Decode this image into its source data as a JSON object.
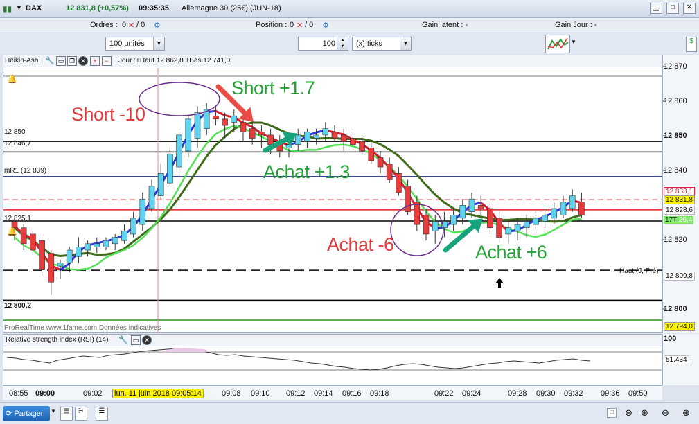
{
  "title_bar": {
    "instrument": "DAX",
    "price_change": "12 831,8 (+0,57%)",
    "time": "09:35:35",
    "contract": "Allemagne 30 (25€) (JUN-18)"
  },
  "orders_bar": {
    "orders_label": "Ordres :",
    "orders_v1": "0",
    "orders_v2": "/ 0",
    "position_label": "Position :",
    "position_v1": "0",
    "position_v2": "/ 0",
    "gain_latent": "Gain latent :  -",
    "gain_jour": "Gain Jour :  -"
  },
  "toolbar": {
    "units": "100 unités",
    "qty": "100",
    "ticks": "(x) ticks"
  },
  "chart_header": {
    "indicator": "Heikin-Ashi",
    "info": "Jour :+Haut 12 862,8 +Bas 12 741,0"
  },
  "chart_labels": {
    "level_12850": "12 850",
    "level_12846": "12 846,7",
    "mr1": "mR1 (12 839)",
    "level_12825": "12 825,1",
    "level_12800": "12 800,2",
    "haut": "Haut (J, Pré)",
    "watermark": "www.1fame.com Données indicatives",
    "watermark_prefix": "ProRealTime"
  },
  "price_axis": {
    "p12870": "12 870",
    "p12860": "12 860",
    "p12850": "12 850",
    "p12840": "12 840",
    "p12833": "12 833,1",
    "p12831": "12 831,8",
    "p12828": "12 828,6",
    "p17t": "17T",
    "p12826": "26,4",
    "p12820": "12 820",
    "p12809": "12 809,8",
    "p12800": "12 800",
    "p12794": "12 794,0"
  },
  "annotations": {
    "short_m10": "Short -10",
    "short_p17": "Short +1.7",
    "achat_p13": "Achat +1.3",
    "achat_m6": "Achat -6",
    "achat_p6": "Achat +6"
  },
  "rsi": {
    "label": "Relative strength index (RSI) (14)",
    "axis_top": "100",
    "value": "51,434"
  },
  "time_axis": {
    "t0855": "08:55",
    "t0900": "09:00",
    "t0902": "09:02",
    "cursor": "lun. 11 juin 2018 09:05:14",
    "t0908": "09:08",
    "t0910": "09:10",
    "t0912": "09:12",
    "t0914": "09:14",
    "t0916": "09:16",
    "t0918": "09:18",
    "t0922": "09:22",
    "t0924": "09:24",
    "t0928": "09:28",
    "t0930": "09:30",
    "t0932": "09:32",
    "t0936": "09:36",
    "t0950": "09:50"
  },
  "bottom": {
    "share": "Partager"
  },
  "chart_data": {
    "type": "candlestick",
    "note_series": [
      "heikin-ashi candles",
      "blue/red moving average",
      "green moving average",
      "dark green moving average"
    ],
    "ylim": [
      12790,
      12873
    ],
    "candles": [
      [
        12825,
        12826,
        12819,
        12823,
        0
      ],
      [
        12823,
        12824,
        12816,
        12818,
        0
      ],
      [
        12821,
        12822,
        12815,
        12816,
        0
      ],
      [
        12819,
        12820,
        12808,
        12810,
        0
      ],
      [
        12815,
        12816,
        12802,
        12806,
        0
      ],
      [
        12811,
        12813,
        12807,
        12812,
        1
      ],
      [
        12812,
        12817,
        12809,
        12816,
        1
      ],
      [
        12814,
        12820,
        12812,
        12817,
        1
      ],
      [
        12816,
        12819,
        12814,
        12818,
        1
      ],
      [
        12817,
        12820,
        12815,
        12818,
        1
      ],
      [
        12817,
        12820,
        12816,
        12819,
        1
      ],
      [
        12818,
        12821,
        12816,
        12820,
        1
      ],
      [
        12819,
        12824,
        12818,
        12822,
        1
      ],
      [
        12821,
        12828,
        12820,
        12826,
        1
      ],
      [
        12824,
        12834,
        12822,
        12832,
        1
      ],
      [
        12829,
        12838,
        12828,
        12836,
        1
      ],
      [
        12833,
        12843,
        12832,
        12840,
        1
      ],
      [
        12837,
        12848,
        12836,
        12846,
        1
      ],
      [
        12842,
        12853,
        12840,
        12852,
        1
      ],
      [
        12847,
        12858,
        12845,
        12857,
        1
      ],
      [
        12851,
        12861,
        12848,
        12859,
        1
      ],
      [
        12854,
        12862,
        12852,
        12860,
        1
      ],
      [
        12857,
        12861,
        12855,
        12858,
        0
      ],
      [
        12857,
        12859,
        12851,
        12855,
        0
      ],
      [
        12856,
        12860,
        12853,
        12858,
        1
      ],
      [
        12856,
        12858,
        12850,
        12853,
        0
      ],
      [
        12854,
        12857,
        12849,
        12851,
        0
      ],
      [
        12853,
        12855,
        12848,
        12852,
        0
      ],
      [
        12852,
        12854,
        12846,
        12849,
        0
      ],
      [
        12850,
        12852,
        12845,
        12847,
        0
      ],
      [
        12848,
        12851,
        12845,
        12849,
        1
      ],
      [
        12849,
        12854,
        12847,
        12852,
        1
      ],
      [
        12850,
        12854,
        12848,
        12853,
        1
      ],
      [
        12851,
        12854,
        12849,
        12852,
        1
      ],
      [
        12852,
        12856,
        12850,
        12854,
        1
      ],
      [
        12853,
        12855,
        12850,
        12851,
        0
      ],
      [
        12852,
        12854,
        12847,
        12850,
        0
      ],
      [
        12851,
        12853,
        12848,
        12849,
        0
      ],
      [
        12850,
        12852,
        12846,
        12847,
        0
      ],
      [
        12848,
        12850,
        12843,
        12844,
        0
      ],
      [
        12845,
        12847,
        12840,
        12842,
        0
      ],
      [
        12843,
        12845,
        12837,
        12838,
        0
      ],
      [
        12840,
        12842,
        12833,
        12834,
        0
      ],
      [
        12836,
        12838,
        12827,
        12828,
        0
      ],
      [
        12831,
        12833,
        12822,
        12824,
        0
      ],
      [
        12827,
        12829,
        12819,
        12821,
        0
      ],
      [
        12825,
        12827,
        12818,
        12822,
        1
      ],
      [
        12823,
        12828,
        12820,
        12825,
        1
      ],
      [
        12824,
        12829,
        12822,
        12827,
        1
      ],
      [
        12826,
        12832,
        12824,
        12830,
        1
      ],
      [
        12828,
        12834,
        12826,
        12832,
        1
      ],
      [
        12830,
        12833,
        12827,
        12829,
        0
      ],
      [
        12829,
        12831,
        12821,
        12823,
        0
      ],
      [
        12826,
        12828,
        12818,
        12820,
        0
      ],
      [
        12823,
        12825,
        12818,
        12821,
        1
      ],
      [
        12822,
        12826,
        12819,
        12824,
        1
      ],
      [
        12823,
        12827,
        12820,
        12825,
        1
      ],
      [
        12824,
        12828,
        12822,
        12826,
        1
      ],
      [
        12825,
        12829,
        12823,
        12827,
        1
      ],
      [
        12826,
        12831,
        12824,
        12829,
        1
      ],
      [
        12827,
        12833,
        12826,
        12831,
        1
      ],
      [
        12829,
        12835,
        12828,
        12833,
        1
      ],
      [
        12831,
        12834,
        12826,
        12827,
        0
      ]
    ]
  }
}
